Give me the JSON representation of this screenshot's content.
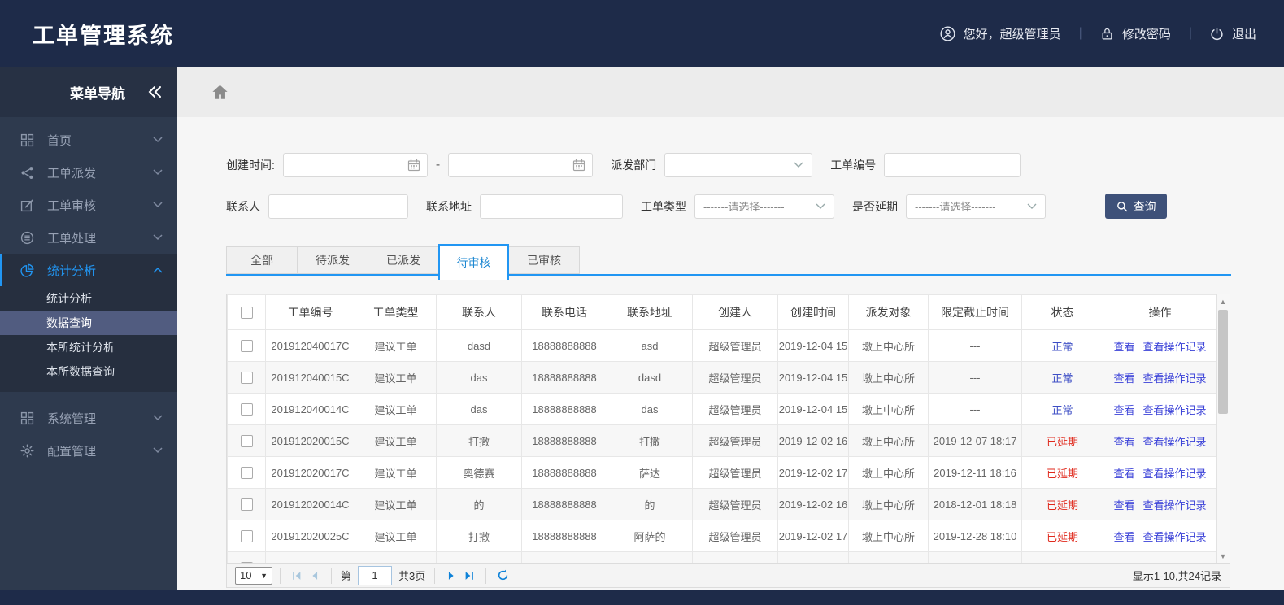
{
  "header": {
    "title": "工单管理系统",
    "greeting": "您好，超级管理员",
    "change_password": "修改密码",
    "logout": "退出",
    "icons": [
      "user-icon",
      "lock-icon",
      "power-icon"
    ]
  },
  "sidebar": {
    "title": "菜单导航",
    "collapse_icon": "double-chevron-left-icon",
    "items": [
      {
        "label": "首页",
        "icon": "grid-icon"
      },
      {
        "label": "工单派发",
        "icon": "share-icon"
      },
      {
        "label": "工单审核",
        "icon": "edit-icon"
      },
      {
        "label": "工单处理",
        "icon": "database-icon"
      },
      {
        "label": "统计分析",
        "icon": "pie-chart-icon",
        "active": true,
        "expanded": true,
        "children": [
          "统计分析",
          "数据查询",
          "本所统计分析",
          "本所数据查询"
        ],
        "active_child": "数据查询"
      },
      {
        "label": "系统管理",
        "icon": "grid-icon"
      },
      {
        "label": "配置管理",
        "icon": "gear-icon"
      }
    ]
  },
  "breadcrumb": {
    "home_icon": "home-icon"
  },
  "filters": {
    "create_time_label": "创建时间:",
    "range_separator": "-",
    "dispatch_dept_label": "派发部门",
    "order_no_label": "工单编号",
    "contact_label": "联系人",
    "address_label": "联系地址",
    "order_type_label": "工单类型",
    "delay_label": "是否延期",
    "select_placeholder": "-------请选择-------",
    "search_button": "查询",
    "calendar_icon": "calendar-icon",
    "search_icon": "search-icon"
  },
  "tabs": [
    {
      "label": "全部",
      "active": false
    },
    {
      "label": "待派发",
      "active": false
    },
    {
      "label": "已派发",
      "active": false
    },
    {
      "label": "待审核",
      "active": true
    },
    {
      "label": "已审核",
      "active": false
    }
  ],
  "table": {
    "columns": [
      "工单编号",
      "工单类型",
      "联系人",
      "联系电话",
      "联系地址",
      "创建人",
      "创建时间",
      "派发对象",
      "限定截止时间",
      "状态",
      "操作"
    ],
    "actions": [
      "查看",
      "查看操作记录"
    ],
    "rows": [
      {
        "order_no": "201912040017C",
        "type": "建议工单",
        "contact": "dasd",
        "phone": "18888888888",
        "address": "asd",
        "creator": "超级管理员",
        "created": "2019-12-04 15",
        "target": "墩上中心所",
        "deadline": "---",
        "status": "正常"
      },
      {
        "order_no": "201912040015C",
        "type": "建议工单",
        "contact": "das",
        "phone": "18888888888",
        "address": "dasd",
        "creator": "超级管理员",
        "created": "2019-12-04 15",
        "target": "墩上中心所",
        "deadline": "---",
        "status": "正常"
      },
      {
        "order_no": "201912040014C",
        "type": "建议工单",
        "contact": "das",
        "phone": "18888888888",
        "address": "das",
        "creator": "超级管理员",
        "created": "2019-12-04 15",
        "target": "墩上中心所",
        "deadline": "---",
        "status": "正常"
      },
      {
        "order_no": "201912020015C",
        "type": "建议工单",
        "contact": "打撒",
        "phone": "18888888888",
        "address": "打撒",
        "creator": "超级管理员",
        "created": "2019-12-02 16",
        "target": "墩上中心所",
        "deadline": "2019-12-07 18:17",
        "status": "已延期"
      },
      {
        "order_no": "201912020017C",
        "type": "建议工单",
        "contact": "奥德赛",
        "phone": "18888888888",
        "address": "萨达",
        "creator": "超级管理员",
        "created": "2019-12-02 17",
        "target": "墩上中心所",
        "deadline": "2019-12-11 18:16",
        "status": "已延期"
      },
      {
        "order_no": "201912020014C",
        "type": "建议工单",
        "contact": "的",
        "phone": "18888888888",
        "address": "的",
        "creator": "超级管理员",
        "created": "2019-12-02 16",
        "target": "墩上中心所",
        "deadline": "2018-12-01 18:18",
        "status": "已延期"
      },
      {
        "order_no": "201912020025C",
        "type": "建议工单",
        "contact": "打撒",
        "phone": "18888888888",
        "address": "阿萨的",
        "creator": "超级管理员",
        "created": "2019-12-02 17",
        "target": "墩上中心所",
        "deadline": "2019-12-28 18:10",
        "status": "已延期"
      }
    ]
  },
  "pagination": {
    "page_size": "10",
    "page_prefix": "第",
    "page_value": "1",
    "total_pages": "共3页",
    "summary": "显示1-10,共24记录",
    "icons": [
      "first-page-icon",
      "prev-page-icon",
      "next-page-icon",
      "last-page-icon",
      "refresh-icon"
    ]
  },
  "colors": {
    "header_bg": "#1e2b49",
    "sidebar_bg": "#2e3a4e",
    "accent_blue": "#2196f3",
    "active_submenu_bg": "#515c80",
    "button_bg": "#3e5179",
    "status_normal": "#3d4ec5",
    "status_delayed": "#e02a1d",
    "link_blue": "#3a41d8",
    "pager_enabled": "#0e82d8",
    "pager_disabled": "#a9c7dd"
  }
}
